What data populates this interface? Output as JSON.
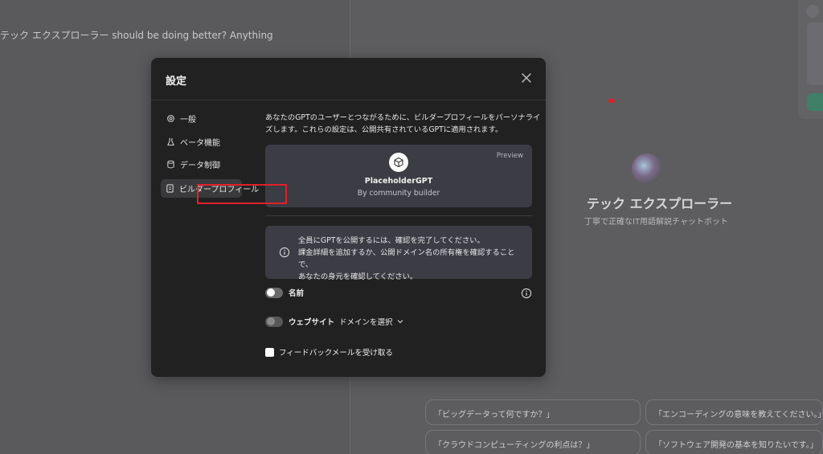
{
  "background": {
    "chat_text": "テック エクスプローラー should be doing better? Anything",
    "gpt_title": "テック エクスプローラー",
    "gpt_subtitle": "丁寧で正確なIT用語解説チャットボット",
    "suggestions": [
      "「ビッグデータって何ですか？」",
      "「エンコーディングの意味を教えてください。」",
      "「クラウドコンピューティングの利点は？」",
      "「ソフトウェア開発の基本を知りたいです。」"
    ]
  },
  "dialog": {
    "title": "設定",
    "close_icon": "close-icon",
    "nav": [
      {
        "label": "一般",
        "icon": "gear-icon"
      },
      {
        "label": "ベータ機能",
        "icon": "flask-icon"
      },
      {
        "label": "データ制御",
        "icon": "database-icon"
      },
      {
        "label": "ビルダープロフィール",
        "icon": "id-card-icon",
        "active": true
      }
    ],
    "description": "あなたのGPTのユーザーとつながるために、ビルダープロフィールをパーソナライズします。これらの設定は、公開共有されているGPTに適用されます。",
    "preview": {
      "tag": "Preview",
      "name": "PlaceholderGPT",
      "by": "By community builder"
    },
    "notice": {
      "line1": "全員にGPTを公開するには、確認を完了してください。",
      "line2": "課金詳細を追加するか、公開ドメイン名の所有権を確認することで、",
      "line3": "あなたの身元を確認してください。"
    },
    "name_toggle": {
      "label": "名前",
      "on": true
    },
    "website_toggle": {
      "label": "ウェブサイト",
      "select_label": "ドメインを選択",
      "on": false
    },
    "feedback_checkbox": {
      "label": "フィードバックメールを受け取る",
      "checked": false
    }
  },
  "colors": {
    "dialog_bg": "#212121",
    "card_bg": "#3c3c45",
    "highlight": "#e0202a",
    "accent_green": "#3f7f68"
  }
}
